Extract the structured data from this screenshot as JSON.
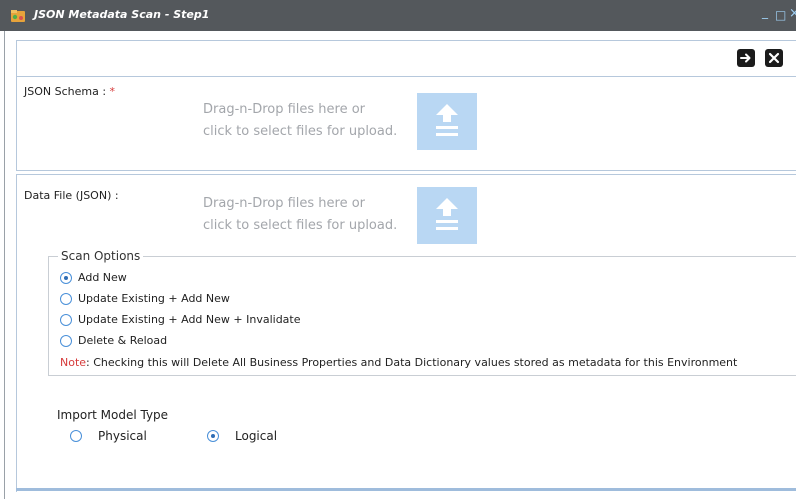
{
  "window": {
    "title": "JSON Metadata Scan - Step1",
    "minimize_label": "_",
    "maximize_label": "□",
    "close_label": "×"
  },
  "schema": {
    "label": "JSON Schema : ",
    "required_mark": "*",
    "drop_line1": "Drag-n-Drop files here or",
    "drop_line2": "click to select files for upload."
  },
  "data_file": {
    "label": "Data File (JSON) :",
    "drop_line1": "Drag-n-Drop files here or",
    "drop_line2": "click to select files for upload."
  },
  "scan_options": {
    "legend": "Scan Options",
    "options": [
      {
        "label": "Add New",
        "selected": true
      },
      {
        "label": "Update Existing + Add New",
        "selected": false
      },
      {
        "label": "Update Existing + Add New + Invalidate",
        "selected": false
      },
      {
        "label": "Delete & Reload",
        "selected": false
      }
    ],
    "note_prefix": "Note",
    "note_text": ": Checking this will Delete All Business Properties and Data Dictionary values stored as metadata for this Environment"
  },
  "import_model_type": {
    "label": "Import Model Type",
    "options": [
      {
        "label": "Physical",
        "selected": false
      },
      {
        "label": "Logical",
        "selected": true
      }
    ]
  },
  "colors": {
    "titlebar": "#54585c",
    "upload_button": "#b9d7f3",
    "required": "#d63b3b",
    "radio_accent": "#2f6db5"
  },
  "icons": {
    "app": "folder-database-icon",
    "next": "arrow-right-icon",
    "close": "close-x-icon",
    "upload": "upload-arrow-icon"
  }
}
